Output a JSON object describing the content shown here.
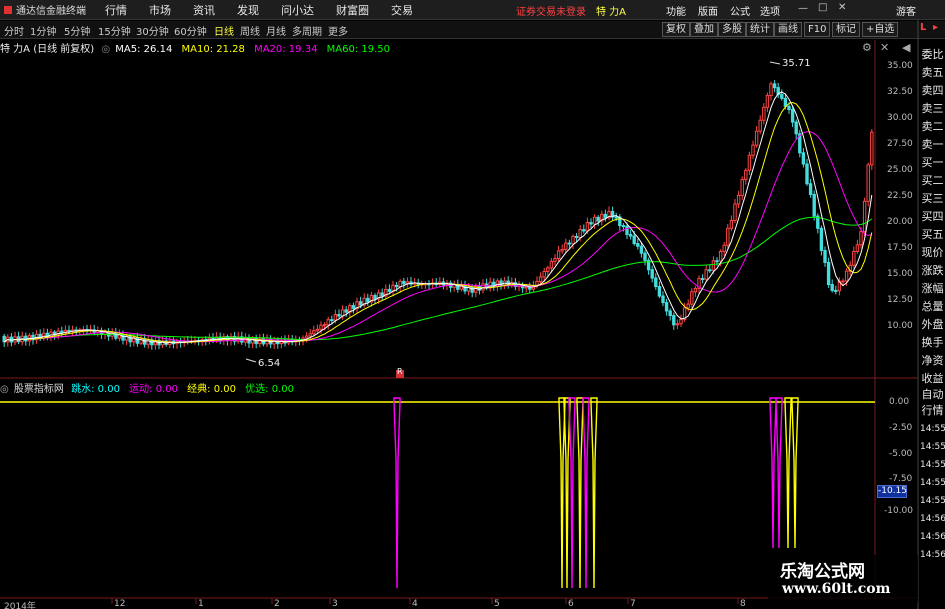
{
  "app": {
    "title": "通达信金融终端",
    "trade_status": "证券交易未登录",
    "stock": "特 力A"
  },
  "menu": [
    "行情",
    "市场",
    "资讯",
    "发现",
    "问小达",
    "财富圈",
    "交易"
  ],
  "top_right": [
    "功能",
    "版面",
    "公式",
    "选项"
  ],
  "guest": "游客",
  "periods": [
    "分时",
    "1分钟",
    "5分钟",
    "15分钟",
    "30分钟",
    "60分钟",
    "日线",
    "周线",
    "月线",
    "多周期",
    "更多"
  ],
  "active_period": "日线",
  "right_buttons": [
    "复权",
    "叠加",
    "多股",
    "统计",
    "画线",
    "F10",
    "标记",
    "+自选"
  ],
  "ma_legend": {
    "name": "特 力A (日线 前复权)",
    "ma5": "MA5: 26.14",
    "ma10": "MA10: 21.28",
    "ma20": "MA20: 19.34",
    "ma60": "MA60: 19.50"
  },
  "indicator_legend": {
    "name": "股票指标网",
    "label1": "跳水:",
    "value1": "0.00",
    "label2": "运动:",
    "value2": "0.00",
    "label3": "经典:",
    "value3": "0.00",
    "label4": "优选:",
    "value4": "0.00"
  },
  "main_y_ticks": [
    "35.00",
    "32.50",
    "30.00",
    "27.50",
    "25.00",
    "22.50",
    "20.00",
    "17.50",
    "15.00",
    "12.50",
    "10.00"
  ],
  "sub_y_ticks": [
    "0.00",
    "-2.50",
    "-5.00",
    "-7.50",
    "-10.00"
  ],
  "sub_y_marker": "-10.15",
  "x_ticks": [
    "2014年",
    "12",
    "1",
    "2",
    "3",
    "4",
    "5",
    "6",
    "7",
    "8"
  ],
  "annotations": {
    "high": "35.71",
    "low": "6.54",
    "event": "R"
  },
  "side_panel": [
    "委比",
    "卖五",
    "卖四",
    "卖三",
    "卖二",
    "卖一",
    "买一",
    "买二",
    "买三",
    "买四",
    "买五",
    "现价",
    "涨跌",
    "涨幅",
    "总量",
    "外盘",
    "换手",
    "净资",
    "收益"
  ],
  "side_bottom": [
    "自动",
    "行情",
    "14:55",
    "14:55",
    "14:55",
    "14:55",
    "14:55",
    "14:56",
    "14:56",
    "14:56"
  ],
  "watermark": {
    "title": "乐淘公式网",
    "url": "www.60lt.com"
  },
  "colors": {
    "up": "#ff4444",
    "down": "#44dddd",
    "ma5": "#ffffff",
    "ma10": "#ffff00",
    "ma20": "#ff00ff",
    "ma60": "#00ff00",
    "yellow": "#ffff40"
  }
}
